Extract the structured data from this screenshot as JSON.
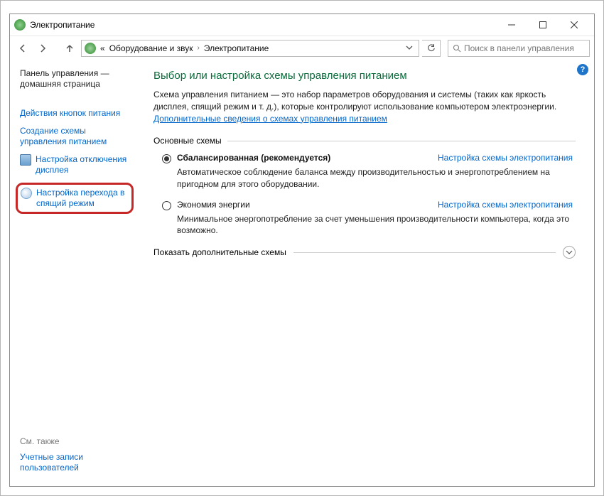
{
  "window": {
    "title": "Электропитание"
  },
  "breadcrumb": {
    "prefix": "«",
    "item1": "Оборудование и звук",
    "item2": "Электропитание"
  },
  "search": {
    "placeholder": "Поиск в панели управления"
  },
  "sidebar": {
    "home": "Панель управления — домашняя страница",
    "links": {
      "buttons": "Действия кнопок питания",
      "create": "Создание схемы управления питанием",
      "display": "Настройка отключения дисплея",
      "sleep": "Настройка перехода в спящий режим"
    },
    "see_also_label": "См. также",
    "see_also_link": "Учетные записи пользователей"
  },
  "content": {
    "heading": "Выбор или настройка схемы управления питанием",
    "desc_text": "Схема управления питанием — это набор параметров оборудования и системы (таких как яркость дисплея, спящий режим и т. д.), которые контролируют использование компьютером электроэнергии. ",
    "desc_link": "Дополнительные сведения о схемах управления питанием",
    "section_main": "Основные схемы",
    "plans": {
      "balanced": {
        "name": "Сбалансированная (рекомендуется)",
        "link": "Настройка схемы электропитания",
        "desc": "Автоматическое соблюдение баланса между производительностью и энергопотреблением на пригодном для этого оборудовании."
      },
      "saver": {
        "name": "Экономия энергии",
        "link": "Настройка схемы электропитания",
        "desc": "Минимальное энергопотребление за счет уменьшения производительности компьютера, когда это возможно."
      }
    },
    "expand_label": "Показать дополнительные схемы"
  }
}
